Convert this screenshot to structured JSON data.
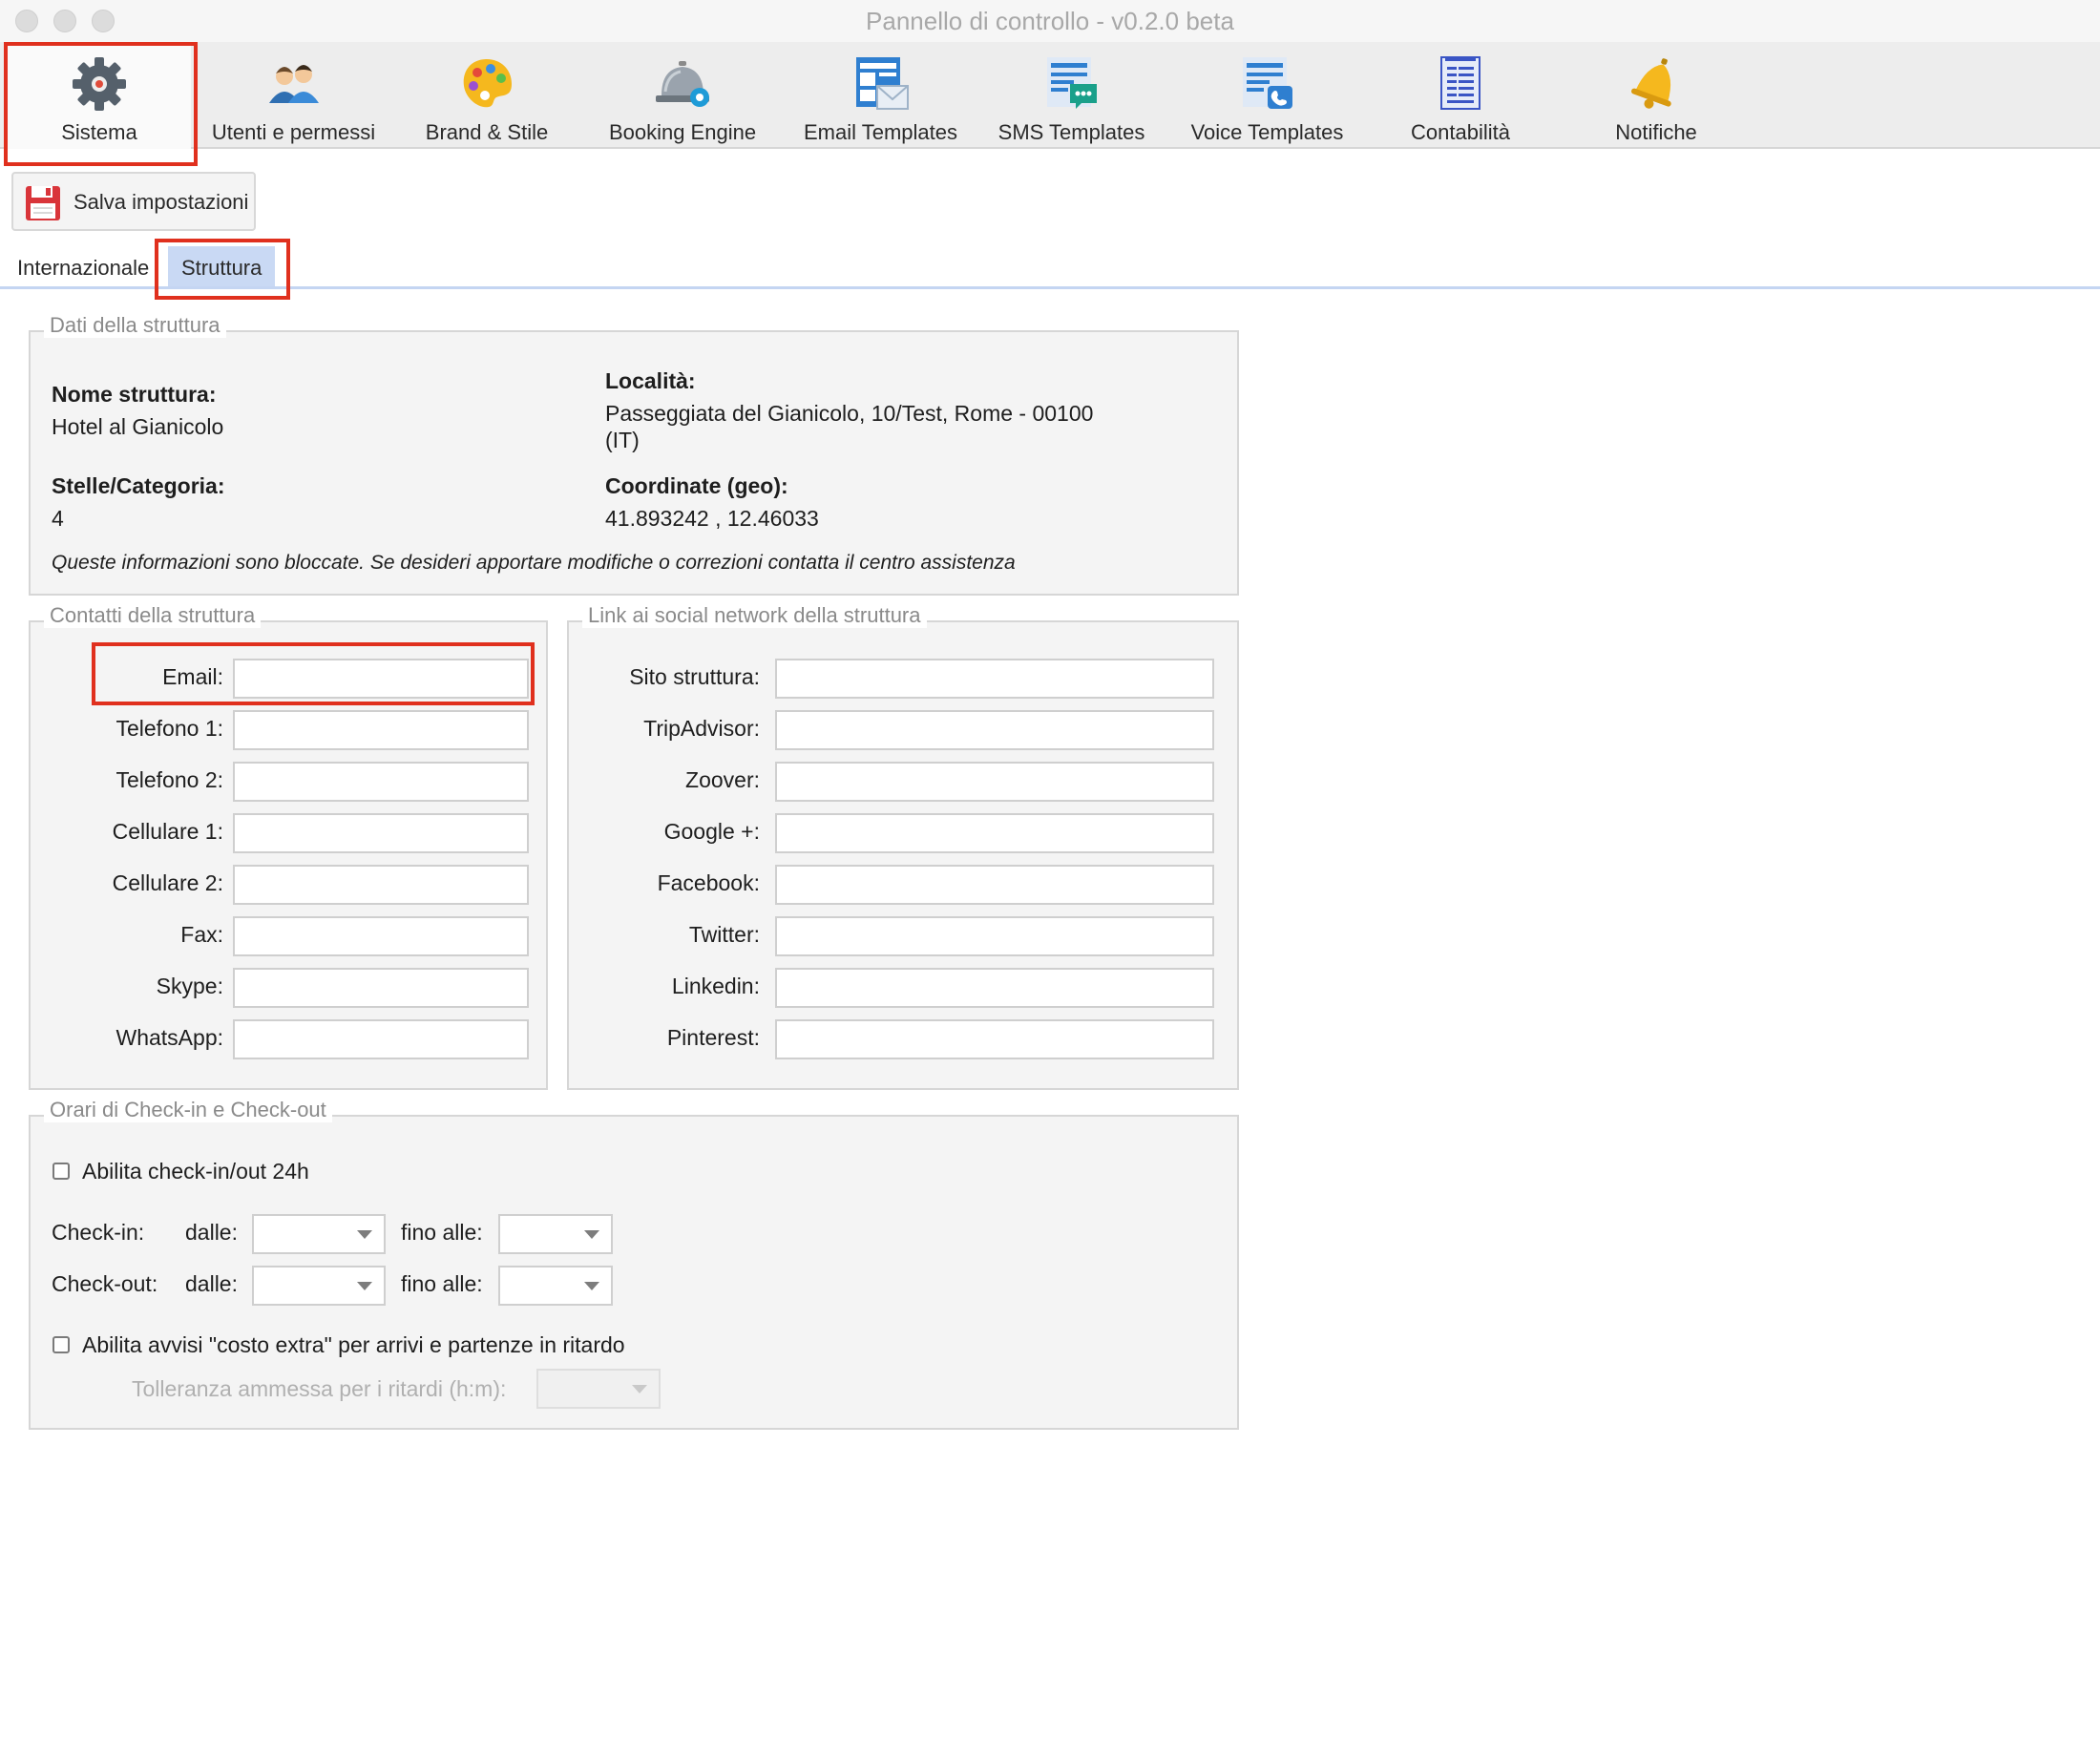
{
  "window": {
    "title": "Pannello di controllo - v0.2.0 beta"
  },
  "toolbar": {
    "items": [
      {
        "label": "Sistema",
        "icon": "gear-icon"
      },
      {
        "label": "Utenti e permessi",
        "icon": "users-icon"
      },
      {
        "label": "Brand & Stile",
        "icon": "palette-icon"
      },
      {
        "label": "Booking Engine",
        "icon": "reception-bell-icon"
      },
      {
        "label": "Email Templates",
        "icon": "email-template-icon"
      },
      {
        "label": "SMS Templates",
        "icon": "sms-template-icon"
      },
      {
        "label": "Voice Templates",
        "icon": "voice-template-icon"
      },
      {
        "label": "Contabilità",
        "icon": "accounting-icon"
      },
      {
        "label": "Notifiche",
        "icon": "bell-icon"
      }
    ],
    "active": "Sistema"
  },
  "actions": {
    "save_label": "Salva impostazioni"
  },
  "tabs": [
    {
      "label": "Internazionale",
      "selected": false
    },
    {
      "label": "Struttura",
      "selected": true
    }
  ],
  "dati": {
    "legend": "Dati della struttura",
    "nome_label": "Nome struttura:",
    "nome_value": "Hotel al Gianicolo",
    "stelle_label": "Stelle/Categoria:",
    "stelle_value": "4",
    "localita_label": "Località:",
    "localita_line1": "Passeggiata del Gianicolo, 10/Test, Rome - 00100",
    "localita_line2": "(IT)",
    "coord_label": "Coordinate (geo):",
    "coord_value": "41.893242 , 12.46033",
    "note": "Queste informazioni sono bloccate. Se desideri apportare modifiche o correzioni contatta il centro assistenza"
  },
  "contatti": {
    "legend": "Contatti della struttura",
    "fields": [
      {
        "label": "Email:",
        "value": ""
      },
      {
        "label": "Telefono 1:",
        "value": ""
      },
      {
        "label": "Telefono 2:",
        "value": ""
      },
      {
        "label": "Cellulare 1:",
        "value": ""
      },
      {
        "label": "Cellulare 2:",
        "value": ""
      },
      {
        "label": "Fax:",
        "value": ""
      },
      {
        "label": "Skype:",
        "value": ""
      },
      {
        "label": "WhatsApp:",
        "value": ""
      }
    ]
  },
  "social": {
    "legend": "Link ai social network della struttura",
    "fields": [
      {
        "label": "Sito struttura:",
        "value": ""
      },
      {
        "label": "TripAdvisor:",
        "value": ""
      },
      {
        "label": "Zoover:",
        "value": ""
      },
      {
        "label": "Google +:",
        "value": ""
      },
      {
        "label": "Facebook:",
        "value": ""
      },
      {
        "label": "Twitter:",
        "value": ""
      },
      {
        "label": "Linkedin:",
        "value": ""
      },
      {
        "label": "Pinterest:",
        "value": ""
      }
    ]
  },
  "orari": {
    "legend": "Orari di Check-in e Check-out",
    "enable_24h_label": "Abilita check-in/out 24h",
    "enable_24h_checked": false,
    "checkin_label": "Check-in:",
    "checkout_label": "Check-out:",
    "dalle_label": "dalle:",
    "fino_label": "fino alle:",
    "checkin_from": "",
    "checkin_to": "",
    "checkout_from": "",
    "checkout_to": "",
    "extra_cost_label": "Abilita avvisi \"costo extra\" per arrivi e partenze in ritardo",
    "extra_cost_checked": false,
    "tolerance_label": "Tolleranza ammessa per i ritardi (h:m):",
    "tolerance_value": ""
  },
  "colors": {
    "highlight": "#e0301e",
    "tab_selected": "#c9d9f4",
    "panel_bg": "#f4f4f4"
  }
}
